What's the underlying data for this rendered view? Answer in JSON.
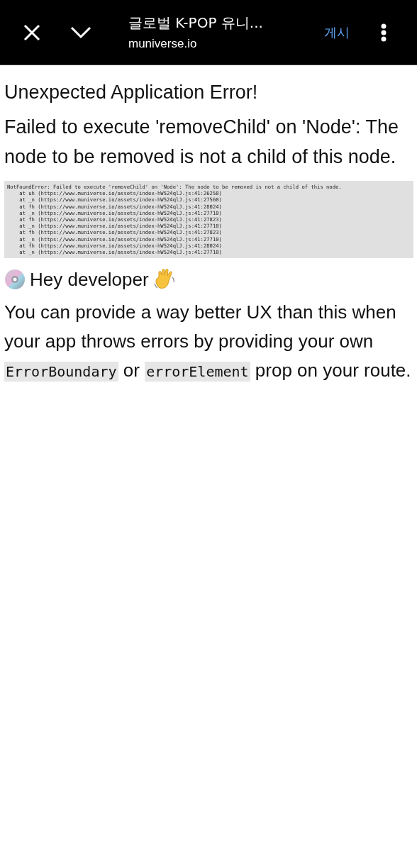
{
  "toolbar": {
    "title": "글로벌 K-POP 유니...",
    "url": "muniverse.io",
    "action": "게시"
  },
  "error": {
    "title": "Unexpected Application Error!",
    "message": "Failed to execute 'removeChild' on 'Node': The node to be removed is not a child of this node.",
    "stack": [
      "NotFoundError: Failed to execute 'removeChild' on 'Node': The node to be removed is not a child of this node.",
      "    at uh (https://www.muniverse.io/assets/index-hW524qlJ.js:41:26258)",
      "    at _n (https://www.muniverse.io/assets/index-hW524qlJ.js:41:27560)",
      "    at fh (https://www.muniverse.io/assets/index-hW524qlJ.js:41:28024)",
      "    at _n (https://www.muniverse.io/assets/index-hW524qlJ.js:41:27710)",
      "    at fh (https://www.muniverse.io/assets/index-hW524qlJ.js:41:27823)",
      "    at _n (https://www.muniverse.io/assets/index-hW524qlJ.js:41:27710)",
      "    at fh (https://www.muniverse.io/assets/index-hW524qlJ.js:41:27823)",
      "    at _n (https://www.muniverse.io/assets/index-hW524qlJ.js:41:27710)",
      "    at fh (https://www.muniverse.io/assets/index-hW524qlJ.js:41:28024)",
      "    at _n (https://www.muniverse.io/assets/index-hW524qlJ.js:41:27710)"
    ]
  },
  "hint": {
    "heading": "Hey developer",
    "parts": [
      {
        "kind": "text",
        "text": "You can provide a way better UX than this when your app throws errors by providing your own "
      },
      {
        "kind": "code",
        "text": "ErrorBoundary"
      },
      {
        "kind": "text",
        "text": " or "
      },
      {
        "kind": "code",
        "text": "errorElement"
      },
      {
        "kind": "text",
        "text": " prop on your route."
      }
    ]
  }
}
